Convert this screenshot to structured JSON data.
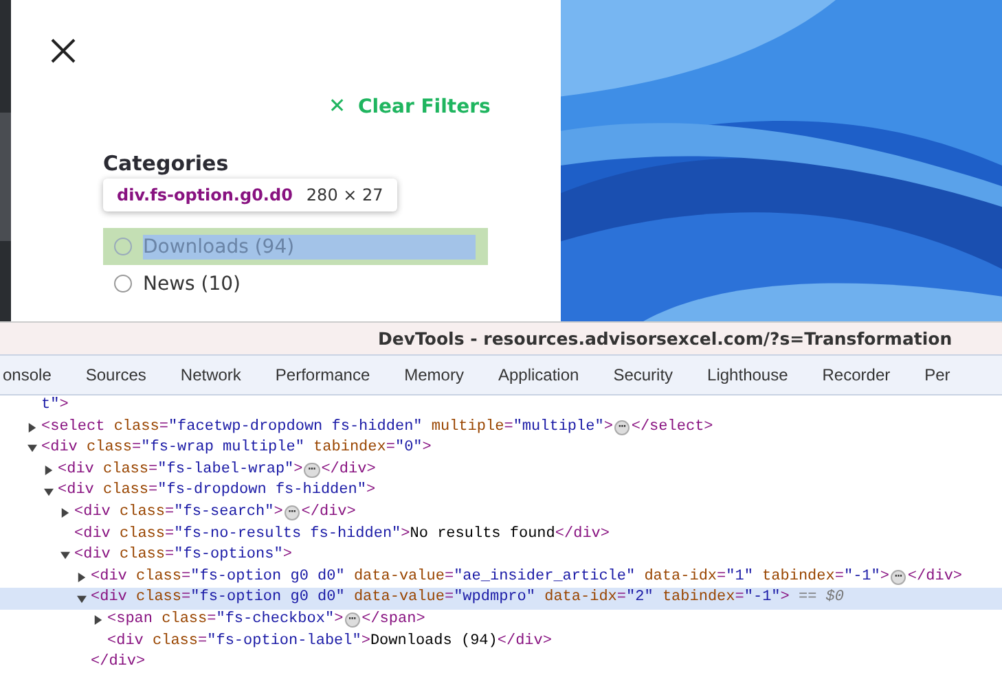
{
  "filter_panel": {
    "clear_filters": {
      "icon": "✕",
      "label": "Clear Filters"
    },
    "heading": "Categories",
    "options": [
      {
        "label": "Downloads (94)",
        "checked": false,
        "inspected": true
      },
      {
        "label": "News (10)",
        "checked": false,
        "inspected": false
      }
    ],
    "inspect_tooltip": {
      "selector": "div.fs-option.g0.d0",
      "size": "280 × 27"
    }
  },
  "devtools": {
    "title": "DevTools - resources.advisorsexcel.com/?s=Transformation",
    "tabs": [
      "onsole",
      "Sources",
      "Network",
      "Performance",
      "Memory",
      "Application",
      "Security",
      "Lighthouse",
      "Recorder",
      "Per"
    ],
    "dom": [
      {
        "selected": false,
        "tokens": [
          {
            "kind": "value",
            "text": "t\""
          },
          {
            "kind": "tag",
            "text": ">"
          }
        ]
      },
      {
        "selected": false,
        "expanded": false,
        "tokens": [
          {
            "kind": "tag",
            "text": "<select"
          },
          {
            "kind": "attr",
            "text": " class"
          },
          {
            "kind": "tag",
            "text": "="
          },
          {
            "kind": "value",
            "text": "\"facetwp-dropdown fs-hidden\""
          },
          {
            "kind": "attr",
            "text": " multiple"
          },
          {
            "kind": "tag",
            "text": "="
          },
          {
            "kind": "value",
            "text": "\"multiple\""
          },
          {
            "kind": "tag",
            "text": ">"
          },
          {
            "kind": "ellipsis",
            "text": "⋯"
          },
          {
            "kind": "tag",
            "text": "</select>"
          }
        ]
      },
      {
        "selected": false,
        "expanded": true,
        "tokens": [
          {
            "kind": "tag",
            "text": "<div"
          },
          {
            "kind": "attr",
            "text": " class"
          },
          {
            "kind": "tag",
            "text": "="
          },
          {
            "kind": "value",
            "text": "\"fs-wrap multiple\""
          },
          {
            "kind": "attr",
            "text": " tabindex"
          },
          {
            "kind": "tag",
            "text": "="
          },
          {
            "kind": "value",
            "text": "\"0\""
          },
          {
            "kind": "tag",
            "text": ">"
          }
        ],
        "children": [
          {
            "selected": false,
            "expanded": false,
            "tokens": [
              {
                "kind": "tag",
                "text": "<div"
              },
              {
                "kind": "attr",
                "text": " class"
              },
              {
                "kind": "tag",
                "text": "="
              },
              {
                "kind": "value",
                "text": "\"fs-label-wrap\""
              },
              {
                "kind": "tag",
                "text": ">"
              },
              {
                "kind": "ellipsis",
                "text": "⋯"
              },
              {
                "kind": "tag",
                "text": "</div>"
              }
            ]
          },
          {
            "selected": false,
            "expanded": true,
            "tokens": [
              {
                "kind": "tag",
                "text": "<div"
              },
              {
                "kind": "attr",
                "text": " class"
              },
              {
                "kind": "tag",
                "text": "="
              },
              {
                "kind": "value",
                "text": "\"fs-dropdown fs-hidden\""
              },
              {
                "kind": "tag",
                "text": ">"
              }
            ],
            "children": [
              {
                "selected": false,
                "expanded": false,
                "tokens": [
                  {
                    "kind": "tag",
                    "text": "<div"
                  },
                  {
                    "kind": "attr",
                    "text": " class"
                  },
                  {
                    "kind": "tag",
                    "text": "="
                  },
                  {
                    "kind": "value",
                    "text": "\"fs-search\""
                  },
                  {
                    "kind": "tag",
                    "text": ">"
                  },
                  {
                    "kind": "ellipsis",
                    "text": "⋯"
                  },
                  {
                    "kind": "tag",
                    "text": "</div>"
                  }
                ]
              },
              {
                "selected": false,
                "tokens": [
                  {
                    "kind": "tag",
                    "text": "<div"
                  },
                  {
                    "kind": "attr",
                    "text": " class"
                  },
                  {
                    "kind": "tag",
                    "text": "="
                  },
                  {
                    "kind": "value",
                    "text": "\"fs-no-results fs-hidden\""
                  },
                  {
                    "kind": "tag",
                    "text": ">"
                  },
                  {
                    "kind": "text",
                    "text": "No results found"
                  },
                  {
                    "kind": "tag",
                    "text": "</div>"
                  }
                ]
              },
              {
                "selected": false,
                "expanded": true,
                "tokens": [
                  {
                    "kind": "tag",
                    "text": "<div"
                  },
                  {
                    "kind": "attr",
                    "text": " class"
                  },
                  {
                    "kind": "tag",
                    "text": "="
                  },
                  {
                    "kind": "value",
                    "text": "\"fs-options\""
                  },
                  {
                    "kind": "tag",
                    "text": ">"
                  }
                ],
                "children": [
                  {
                    "selected": false,
                    "expanded": false,
                    "tokens": [
                      {
                        "kind": "tag",
                        "text": "<div"
                      },
                      {
                        "kind": "attr",
                        "text": " class"
                      },
                      {
                        "kind": "tag",
                        "text": "="
                      },
                      {
                        "kind": "value",
                        "text": "\"fs-option g0 d0\""
                      },
                      {
                        "kind": "attr",
                        "text": " data-value"
                      },
                      {
                        "kind": "tag",
                        "text": "="
                      },
                      {
                        "kind": "value",
                        "text": "\"ae_insider_article\""
                      },
                      {
                        "kind": "attr",
                        "text": " data-idx"
                      },
                      {
                        "kind": "tag",
                        "text": "="
                      },
                      {
                        "kind": "value",
                        "text": "\"1\""
                      },
                      {
                        "kind": "attr",
                        "text": " tabindex"
                      },
                      {
                        "kind": "tag",
                        "text": "="
                      },
                      {
                        "kind": "value",
                        "text": "\"-1\""
                      },
                      {
                        "kind": "tag",
                        "text": ">"
                      },
                      {
                        "kind": "ellipsis",
                        "text": "⋯"
                      },
                      {
                        "kind": "tag",
                        "text": "</div>"
                      }
                    ]
                  },
                  {
                    "selected": true,
                    "expanded": true,
                    "tokens": [
                      {
                        "kind": "tag",
                        "text": "<div"
                      },
                      {
                        "kind": "attr",
                        "text": " class"
                      },
                      {
                        "kind": "tag",
                        "text": "="
                      },
                      {
                        "kind": "value",
                        "text": "\"fs-option g0 d0\""
                      },
                      {
                        "kind": "attr",
                        "text": " data-value"
                      },
                      {
                        "kind": "tag",
                        "text": "="
                      },
                      {
                        "kind": "value",
                        "text": "\"wpdmpro\""
                      },
                      {
                        "kind": "attr",
                        "text": " data-idx"
                      },
                      {
                        "kind": "tag",
                        "text": "="
                      },
                      {
                        "kind": "value",
                        "text": "\"2\""
                      },
                      {
                        "kind": "attr",
                        "text": " tabindex"
                      },
                      {
                        "kind": "tag",
                        "text": "="
                      },
                      {
                        "kind": "value",
                        "text": "\"-1\""
                      },
                      {
                        "kind": "tag",
                        "text": ">"
                      },
                      {
                        "kind": "note",
                        "text": " == "
                      },
                      {
                        "kind": "var",
                        "text": "$0"
                      }
                    ],
                    "children": [
                      {
                        "selected": false,
                        "expanded": false,
                        "tokens": [
                          {
                            "kind": "tag",
                            "text": "<span"
                          },
                          {
                            "kind": "attr",
                            "text": " class"
                          },
                          {
                            "kind": "tag",
                            "text": "="
                          },
                          {
                            "kind": "value",
                            "text": "\"fs-checkbox\""
                          },
                          {
                            "kind": "tag",
                            "text": ">"
                          },
                          {
                            "kind": "ellipsis",
                            "text": "⋯"
                          },
                          {
                            "kind": "tag",
                            "text": "</span>"
                          }
                        ]
                      },
                      {
                        "selected": false,
                        "tokens": [
                          {
                            "kind": "tag",
                            "text": "<div"
                          },
                          {
                            "kind": "attr",
                            "text": " class"
                          },
                          {
                            "kind": "tag",
                            "text": "="
                          },
                          {
                            "kind": "value",
                            "text": "\"fs-option-label\""
                          },
                          {
                            "kind": "tag",
                            "text": ">"
                          },
                          {
                            "kind": "text",
                            "text": "Downloads (94)"
                          },
                          {
                            "kind": "tag",
                            "text": "</div>"
                          }
                        ]
                      }
                    ],
                    "closing": [
                      {
                        "kind": "tag",
                        "text": "</div>"
                      }
                    ]
                  }
                ]
              }
            ]
          }
        ]
      }
    ]
  }
}
